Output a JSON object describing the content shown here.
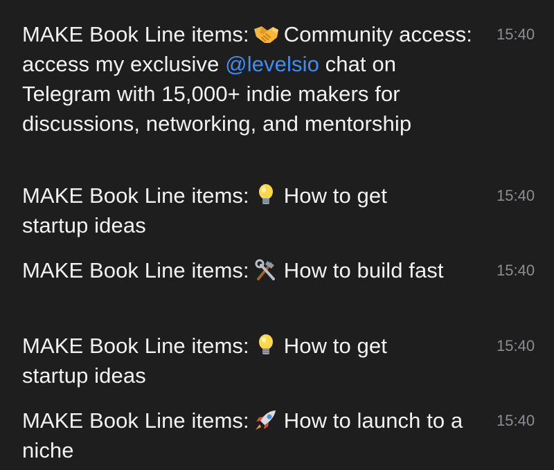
{
  "chat": {
    "messages": [
      {
        "prefix": "MAKE Book Line items:",
        "icon": "handshake-icon",
        "before_mention": "Community access: access my exclusive",
        "mention": "@levelsio",
        "text": "chat on Telegram with 15,000+ indie makers for discussions, networking, and mentorship",
        "time": "15:40"
      },
      {
        "prefix": "MAKE Book Line items:",
        "icon": "lightbulb-icon",
        "text": "How to get startup ideas",
        "time": "15:40"
      },
      {
        "prefix": "MAKE Book Line items:",
        "icon": "hammer-wrench-icon",
        "text": "How to build fast",
        "time": "15:40"
      },
      {
        "prefix": "MAKE Book Line items:",
        "icon": "lightbulb-icon",
        "text": "How to get startup ideas",
        "time": "15:40"
      },
      {
        "prefix": "MAKE Book Line items:",
        "icon": "rocket-icon",
        "text": "How to launch to a niche",
        "time": "15:40"
      }
    ]
  },
  "colors": {
    "background": "#1e1e1e",
    "text": "#f2f2f2",
    "timestamp": "#8d8d93",
    "mention": "#3e8ef7"
  }
}
